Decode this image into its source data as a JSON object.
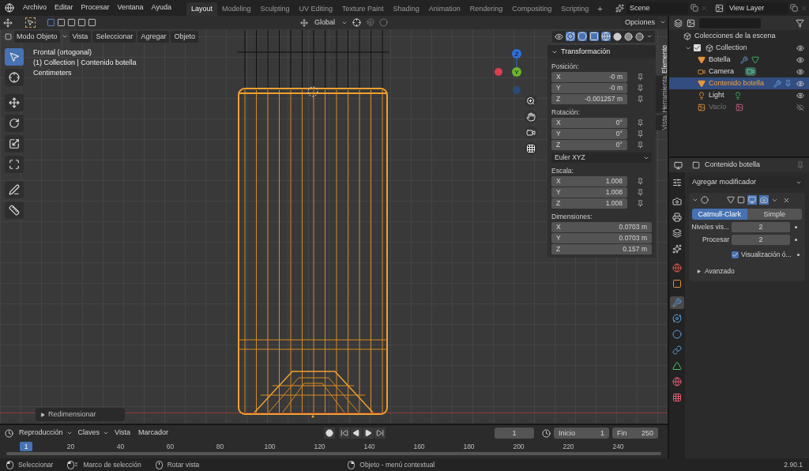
{
  "menu": [
    "Archivo",
    "Editar",
    "Procesar",
    "Ventana",
    "Ayuda"
  ],
  "workspaces": [
    {
      "label": "Layout",
      "selected": true
    },
    {
      "label": "Modeling",
      "selected": false
    },
    {
      "label": "Sculpting",
      "selected": false
    },
    {
      "label": "UV Editing",
      "selected": false
    },
    {
      "label": "Texture Paint",
      "selected": false
    },
    {
      "label": "Shading",
      "selected": false
    },
    {
      "label": "Animation",
      "selected": false
    },
    {
      "label": "Rendering",
      "selected": false
    },
    {
      "label": "Compositing",
      "selected": false
    },
    {
      "label": "Scripting",
      "selected": false
    }
  ],
  "add_workspace": "+",
  "scene": "Scene",
  "view_layer": "View Layer",
  "viewport": {
    "orientation": "Global",
    "options": "Opciones",
    "mode": "Modo Objeto",
    "menus": [
      "Vista",
      "Seleccionar",
      "Agregar",
      "Objeto"
    ],
    "info": [
      "Frontal (ortogonal)",
      "(1) Collection | Contenido botella",
      "Centimeters"
    ],
    "gizmo": [
      "Z",
      "Y"
    ],
    "tools": [
      {
        "kind": "select",
        "selected": true
      },
      {
        "kind": "cursor",
        "selected": false
      },
      {
        "kind": "move",
        "selected": false
      },
      {
        "kind": "rotate",
        "selected": false
      },
      {
        "kind": "scale",
        "selected": false
      },
      {
        "kind": "transform",
        "selected": false
      },
      {
        "kind": "annotate",
        "selected": false
      },
      {
        "kind": "measure",
        "selected": false
      }
    ],
    "last_operation": {
      "label": "Redimensionar",
      "expanded": false
    }
  },
  "sidebar": {
    "tabs": [
      {
        "label": "Elemento",
        "selected": true
      },
      {
        "label": "Herramienta",
        "selected": false
      },
      {
        "label": "Vista",
        "selected": false
      }
    ],
    "panel": {
      "title": "Transformación",
      "expanded": true
    },
    "groups": [
      {
        "label": "Posición:",
        "locks": true,
        "fields": [
          {
            "axis": "X",
            "value": "-0 m"
          },
          {
            "axis": "Y",
            "value": "-0 m"
          },
          {
            "axis": "Z",
            "value": "-0.001257 m"
          }
        ]
      },
      {
        "label": "Rotación:",
        "locks": true,
        "mode": "Euler XYZ",
        "fields": [
          {
            "axis": "X",
            "value": "0°"
          },
          {
            "axis": "Y",
            "value": "0°"
          },
          {
            "axis": "Z",
            "value": "0°"
          }
        ]
      },
      {
        "label": "Escala:",
        "locks": true,
        "fields": [
          {
            "axis": "X",
            "value": "1.008"
          },
          {
            "axis": "Y",
            "value": "1.008"
          },
          {
            "axis": "Z",
            "value": "1.008"
          }
        ]
      },
      {
        "label": "Dimensiones:",
        "locks": false,
        "fields": [
          {
            "axis": "X",
            "value": "0.0703 m"
          },
          {
            "axis": "Y",
            "value": "0.0703 m"
          },
          {
            "axis": "Z",
            "value": "0.157 m"
          }
        ]
      }
    ]
  },
  "outliner": {
    "root": "Colecciones de la escena",
    "collection": {
      "label": "Collection",
      "checked": true,
      "expanded": true,
      "visible": true
    },
    "items": [
      {
        "label": "Botella",
        "kind": "mesh",
        "selected": false,
        "visible": true
      },
      {
        "label": "Camera",
        "kind": "camera",
        "selected": false,
        "visible": true
      },
      {
        "label": "Contenido botella",
        "kind": "mesh",
        "selected": true,
        "visible": true
      },
      {
        "label": "Light",
        "kind": "light",
        "selected": false,
        "visible": true
      },
      {
        "label": "Vacío",
        "kind": "empty",
        "selected": false,
        "visible": false
      }
    ]
  },
  "properties": {
    "object": "Contenido botella",
    "tabs": [
      {
        "kind": "tool",
        "selected": false
      },
      {
        "kind": "render",
        "selected": false
      },
      {
        "kind": "output",
        "selected": false
      },
      {
        "kind": "view_layer",
        "selected": false
      },
      {
        "kind": "scene",
        "selected": false
      },
      {
        "kind": "world",
        "selected": false
      },
      {
        "kind": "object",
        "selected": false
      },
      {
        "kind": "modifier",
        "selected": true
      },
      {
        "kind": "particles",
        "selected": false
      },
      {
        "kind": "physics",
        "selected": false
      },
      {
        "kind": "constraints",
        "selected": false
      },
      {
        "kind": "data",
        "selected": false
      },
      {
        "kind": "material",
        "selected": false
      },
      {
        "kind": "texture",
        "selected": false
      }
    ],
    "add_modifier": "Agregar modificador",
    "modifier": {
      "expanded": true,
      "types": [
        {
          "label": "Catmull-Clark",
          "selected": true
        },
        {
          "label": "Simple",
          "selected": false
        }
      ],
      "fields": [
        {
          "label": "Niveles vis...",
          "value": "2"
        },
        {
          "label": "Procesar",
          "value": "2"
        }
      ],
      "checkbox": {
        "label": "Visualización ó...",
        "checked": true
      },
      "subpanel": {
        "label": "Avanzado",
        "expanded": false
      }
    }
  },
  "timeline": {
    "menus": [
      "Reproducción",
      "Claves",
      "Vista",
      "Marcador"
    ],
    "current_frame": "1",
    "start_label": "Inicio",
    "start": "1",
    "end_label": "Fin",
    "end": "250",
    "ruler": [
      {
        "label": "1",
        "kind": "current"
      },
      {
        "label": "20",
        "kind": "tick"
      },
      {
        "label": "40",
        "kind": "tick"
      },
      {
        "label": "60",
        "kind": "tick"
      },
      {
        "label": "80",
        "kind": "tick"
      },
      {
        "label": "100",
        "kind": "tick"
      },
      {
        "label": "120",
        "kind": "tick"
      },
      {
        "label": "140",
        "kind": "tick"
      },
      {
        "label": "160",
        "kind": "tick"
      },
      {
        "label": "180",
        "kind": "tick"
      },
      {
        "label": "200",
        "kind": "tick"
      },
      {
        "label": "220",
        "kind": "tick"
      },
      {
        "label": "240",
        "kind": "tick"
      }
    ]
  },
  "status": {
    "hints": [
      {
        "label": "Seleccionar",
        "kind": "left"
      },
      {
        "label": "Marco de selección",
        "kind": "drag"
      },
      {
        "label": "Rotar vista",
        "kind": "middle"
      },
      {
        "label": "Objeto - menú contextual",
        "kind": "right"
      }
    ],
    "version": "2.90.1"
  }
}
